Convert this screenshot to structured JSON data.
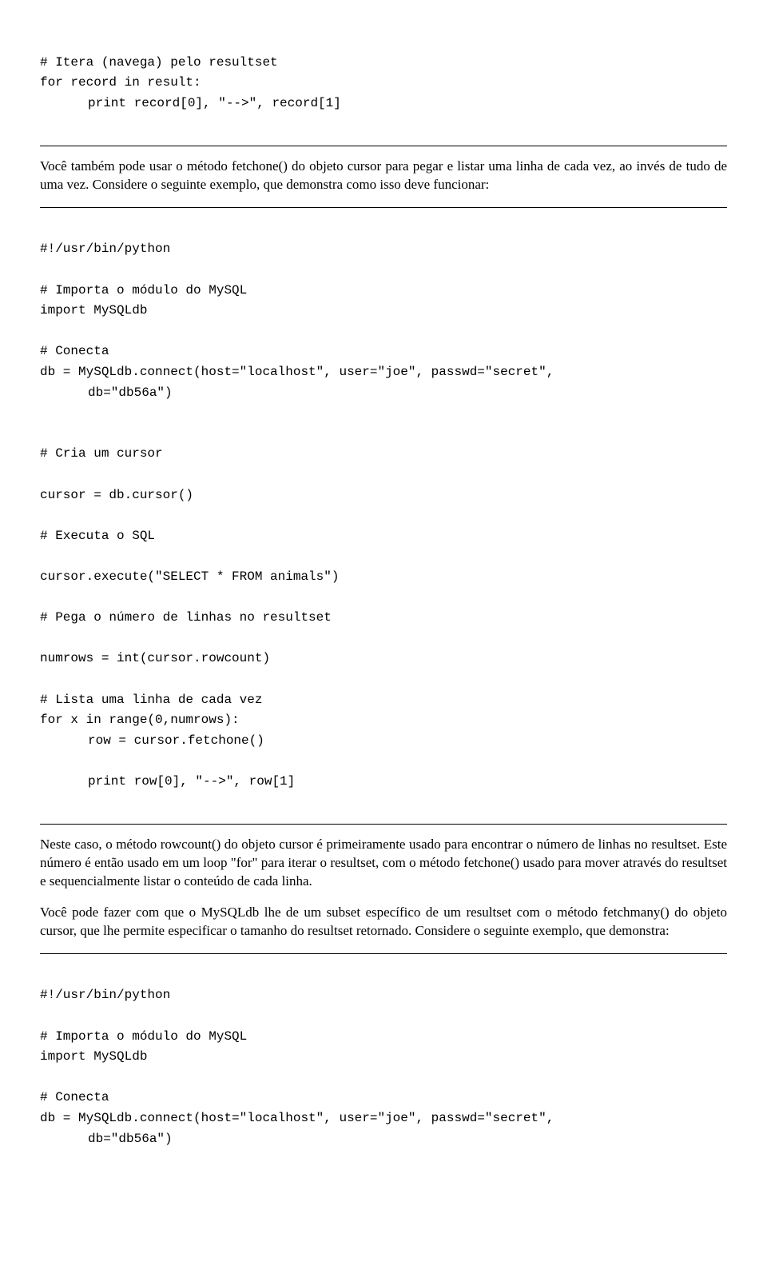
{
  "code1": {
    "l1": "# Itera (navega) pelo resultset",
    "l2": "for record in result:",
    "l3": "print record[0], \"-->\", record[1]"
  },
  "prose1": "Você também pode usar o método fetchone() do objeto cursor para pegar e listar uma linha de cada vez, ao invés de tudo de uma vez. Considere o seguinte exemplo, que demonstra como isso deve funcionar:",
  "code2": {
    "l1": "#!/usr/bin/python",
    "l2": "# Importa o módulo do MySQL",
    "l3": "import MySQLdb",
    "l4": "# Conecta",
    "l5": "db = MySQLdb.connect(host=\"localhost\", user=\"joe\", passwd=\"secret\",",
    "l5b": "db=\"db56a\")",
    "l6": "# Cria um cursor",
    "l7": "cursor = db.cursor()",
    "l8": "# Executa o SQL",
    "l9": "cursor.execute(\"SELECT * FROM animals\")",
    "l10": "# Pega o número de linhas no resultset",
    "l11": "numrows = int(cursor.rowcount)",
    "l12": "# Lista uma linha de cada vez",
    "l13": "for x in range(0,numrows):",
    "l14": "row = cursor.fetchone()",
    "l15": "print row[0], \"-->\", row[1]"
  },
  "prose2": "Neste caso, o método rowcount() do objeto cursor é primeiramente usado para encontrar o número de linhas no resultset. Este número é então usado em um loop \"for\" para iterar o resultset, com o método fetchone() usado para mover através do resultset e sequencialmente listar o conteúdo de cada linha.",
  "prose3": "Você pode fazer com que o MySQLdb lhe de um subset específico de um resultset com o método fetchmany() do objeto cursor, que lhe permite especificar o tamanho do resultset retornado. Considere o seguinte exemplo, que demonstra:",
  "code3": {
    "l1": "#!/usr/bin/python",
    "l2": "# Importa o módulo do MySQL",
    "l3": "import MySQLdb",
    "l4": "# Conecta",
    "l5": "db = MySQLdb.connect(host=\"localhost\", user=\"joe\", passwd=\"secret\",",
    "l5b": "db=\"db56a\")"
  }
}
